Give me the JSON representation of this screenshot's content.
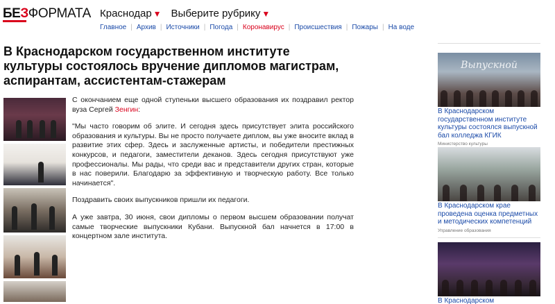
{
  "header": {
    "logo_bez_1": "БЕ",
    "logo_bez_2": "З",
    "logo_rest": "ФОРМАТА",
    "region": "Краснодар",
    "rubric": "Выберите рубрику"
  },
  "nav": [
    {
      "label": "Главное",
      "accent": false
    },
    {
      "label": "Архив",
      "accent": false
    },
    {
      "label": "Источники",
      "accent": false
    },
    {
      "label": "Погода",
      "accent": false
    },
    {
      "label": "Коронавирус",
      "accent": true
    },
    {
      "label": "Происшествия",
      "accent": false
    },
    {
      "label": "Пожары",
      "accent": false
    },
    {
      "label": "На воде",
      "accent": false
    }
  ],
  "article": {
    "title": "В Краснодарском государственном институте культуры состоялось вручение дипломов магистрам, аспирантам, ассистентам-стажерам",
    "p1_text": "С окончанием еще одной ступеньки высшего образования их поздравил ректор вуза Сергей ",
    "p1_link": "Зенгин",
    "p1_end": ":",
    "p2": "\"Мы часто говорим об элите. И сегодня здесь присутствует элита российского образования и культуры. Вы не просто получаете диплом, вы уже вносите вклад в развитие этих сфер. Здесь и заслуженные артисты, и победители престижных конкурсов, и педагоги, заместители деканов. Здесь сегодня присутствуют уже профессионалы. Мы рады, что среди вас и представители других стран, которые в нас поверили. Благодарю за эффективную и творческую работу. Все только начинается\".",
    "p3": "Поздравить своих выпускников пришли их педагоги.",
    "p4": "А уже завтра, 30 июня, свои дипломы о первом высшем образовании получат самые творческие выпускники Кубани. Выпускной бал начнется в 17:00 в концертном зале института."
  },
  "sidebar": {
    "cards": [
      {
        "image_caption": "Выпускной",
        "title": "В Краснодарском государственном институте культуры состоялся выпускной бал колледжа КГИК",
        "source": "Министерство культуры"
      },
      {
        "title": "В Краснодарском крае проведена оценка предметных и методических компетенций",
        "source": "Управление образования"
      },
      {
        "title": "В Краснодарском государственном"
      }
    ]
  },
  "colors": {
    "accent_red": "#d9001b",
    "link_blue": "#1a4aa8"
  }
}
